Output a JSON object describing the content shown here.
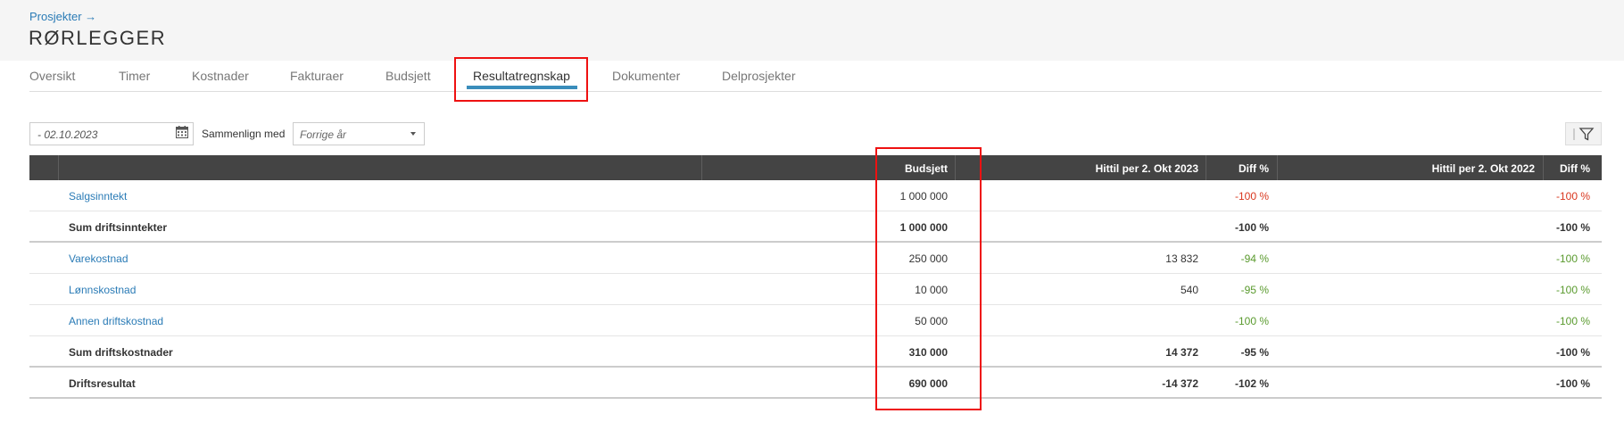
{
  "breadcrumb": {
    "label": "Prosjekter",
    "arrow": "→"
  },
  "page_title": "RØRLEGGER",
  "tabs": [
    {
      "label": "Oversikt"
    },
    {
      "label": "Timer"
    },
    {
      "label": "Kostnader"
    },
    {
      "label": "Fakturaer"
    },
    {
      "label": "Budsjett"
    },
    {
      "label": "Resultatregnskap",
      "active": true
    },
    {
      "label": "Dokumenter"
    },
    {
      "label": "Delprosjekter"
    }
  ],
  "filters": {
    "date_value": "- 02.10.2023",
    "compare_label": "Sammenlign med",
    "compare_value": "Forrige år"
  },
  "table": {
    "headers": {
      "budget": "Budsjett",
      "ytd_current": "Hittil per 2. Okt 2023",
      "diff_current": "Diff %",
      "ytd_previous": "Hittil per 2. Okt 2022",
      "diff_previous": "Diff %"
    },
    "rows": [
      {
        "name": "Salgsinntekt",
        "type": "account",
        "budget": "1 000 000",
        "ytd_current": "",
        "diff_current": "-100 %",
        "ytd_previous": "",
        "diff_previous": "-100 %"
      },
      {
        "name": "Sum driftsinntekter",
        "type": "sum",
        "budget": "1 000 000",
        "ytd_current": "",
        "diff_current": "-100 %",
        "ytd_previous": "",
        "diff_previous": "-100 %"
      },
      {
        "name": "Varekostnad",
        "type": "account",
        "budget": "250 000",
        "ytd_current": "13 832",
        "diff_current": "-94 %",
        "ytd_previous": "",
        "diff_previous": "-100 %"
      },
      {
        "name": "Lønnskostnad",
        "type": "account",
        "budget": "10 000",
        "ytd_current": "540",
        "diff_current": "-95 %",
        "ytd_previous": "",
        "diff_previous": "-100 %"
      },
      {
        "name": "Annen driftskostnad",
        "type": "account",
        "budget": "50 000",
        "ytd_current": "",
        "diff_current": "-100 %",
        "ytd_previous": "",
        "diff_previous": "-100 %"
      },
      {
        "name": "Sum driftskostnader",
        "type": "sum",
        "budget": "310 000",
        "ytd_current": "14 372",
        "diff_current": "-95 %",
        "ytd_previous": "",
        "diff_previous": "-100 %"
      },
      {
        "name": "Driftsresultat",
        "type": "sum",
        "budget": "690 000",
        "ytd_current": "-14 372",
        "diff_current": "-102 %",
        "ytd_previous": "",
        "diff_previous": "-100 %"
      }
    ]
  },
  "colors": {
    "link": "#2a7bb6",
    "negative_income": "#d9371f",
    "positive_cost": "#5a9a2e",
    "header_bg": "#444444",
    "highlight": "#e11111"
  }
}
